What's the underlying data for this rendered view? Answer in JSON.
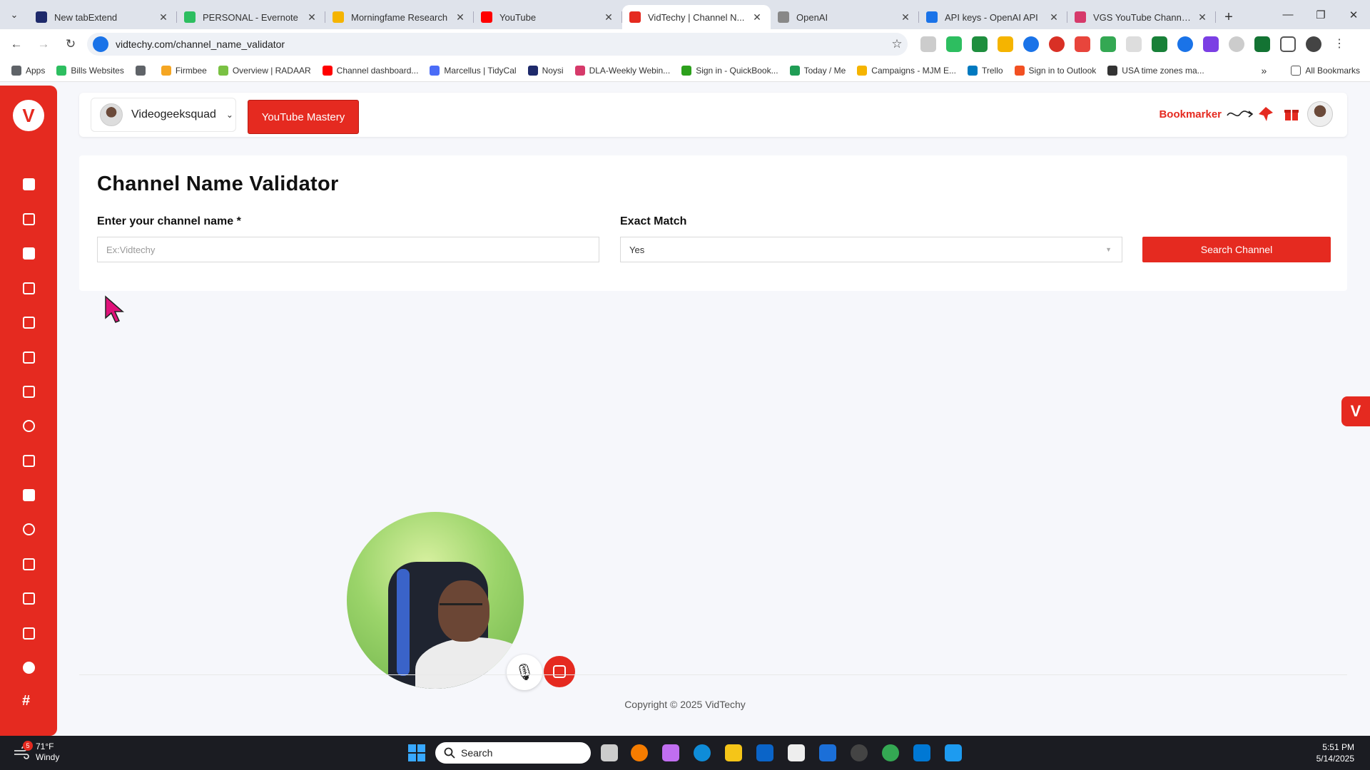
{
  "browser": {
    "tabs": [
      {
        "title": "New tabExtend",
        "color": "#1e2a6b"
      },
      {
        "title": "PERSONAL - Evernote",
        "color": "#2dbe60"
      },
      {
        "title": "Morningfame Research",
        "color": "#f5b400"
      },
      {
        "title": "YouTube",
        "color": "#ff0000"
      },
      {
        "title": "VidTechy | Channel N...",
        "color": "#e52a20",
        "active": true
      },
      {
        "title": "OpenAI",
        "color": "#888888"
      },
      {
        "title": "API keys - OpenAI API",
        "color": "#1a73e8"
      },
      {
        "title": "VGS YouTube Channel - ...",
        "color": "#d63a6a"
      }
    ],
    "url": "vidtechy.com/channel_name_validator",
    "bookmarks": [
      {
        "label": "Apps",
        "color": "#5f6368"
      },
      {
        "label": "Bills Websites",
        "color": "#2dbe60"
      },
      {
        "label": "",
        "color": "#5f6368"
      },
      {
        "label": "Firmbee",
        "color": "#f5a623"
      },
      {
        "label": "Overview | RADAAR",
        "color": "#7ac143"
      },
      {
        "label": "Channel dashboard...",
        "color": "#ff0000"
      },
      {
        "label": "Marcellus | TidyCal",
        "color": "#4a6cf7"
      },
      {
        "label": "Noysi",
        "color": "#1e2a6b"
      },
      {
        "label": "DLA-Weekly Webin...",
        "color": "#d63a6a"
      },
      {
        "label": "Sign in - QuickBook...",
        "color": "#2ca01c"
      },
      {
        "label": "Today / Me",
        "color": "#1f9d55"
      },
      {
        "label": "Campaigns - MJM E...",
        "color": "#f5b400"
      },
      {
        "label": "Trello",
        "color": "#0079bf"
      },
      {
        "label": "Sign in to Outlook",
        "color": "#f25022"
      },
      {
        "label": "USA time zones ma...",
        "color": "#333333"
      }
    ],
    "all_bookmarks": "All Bookmarks",
    "more": "»"
  },
  "header": {
    "channel_name": "Videogeeksquad",
    "mastery_button": "YouTube Mastery",
    "bookmarker_label": "Bookmarker"
  },
  "form": {
    "title": "Channel Name Validator",
    "channel_label": "Enter your channel name *",
    "channel_placeholder": "Ex:Vidtechy",
    "exact_match_label": "Exact Match",
    "exact_match_value": "Yes",
    "search_button": "Search Channel"
  },
  "footer": {
    "copyright": "Copyright © 2025 VidTechy"
  },
  "taskbar": {
    "temperature": "71°F",
    "weather": "Windy",
    "weather_badge": "5",
    "search_label": "Search",
    "time": "5:51 PM",
    "date": "5/14/2025"
  },
  "accent_color": "#e52a20"
}
